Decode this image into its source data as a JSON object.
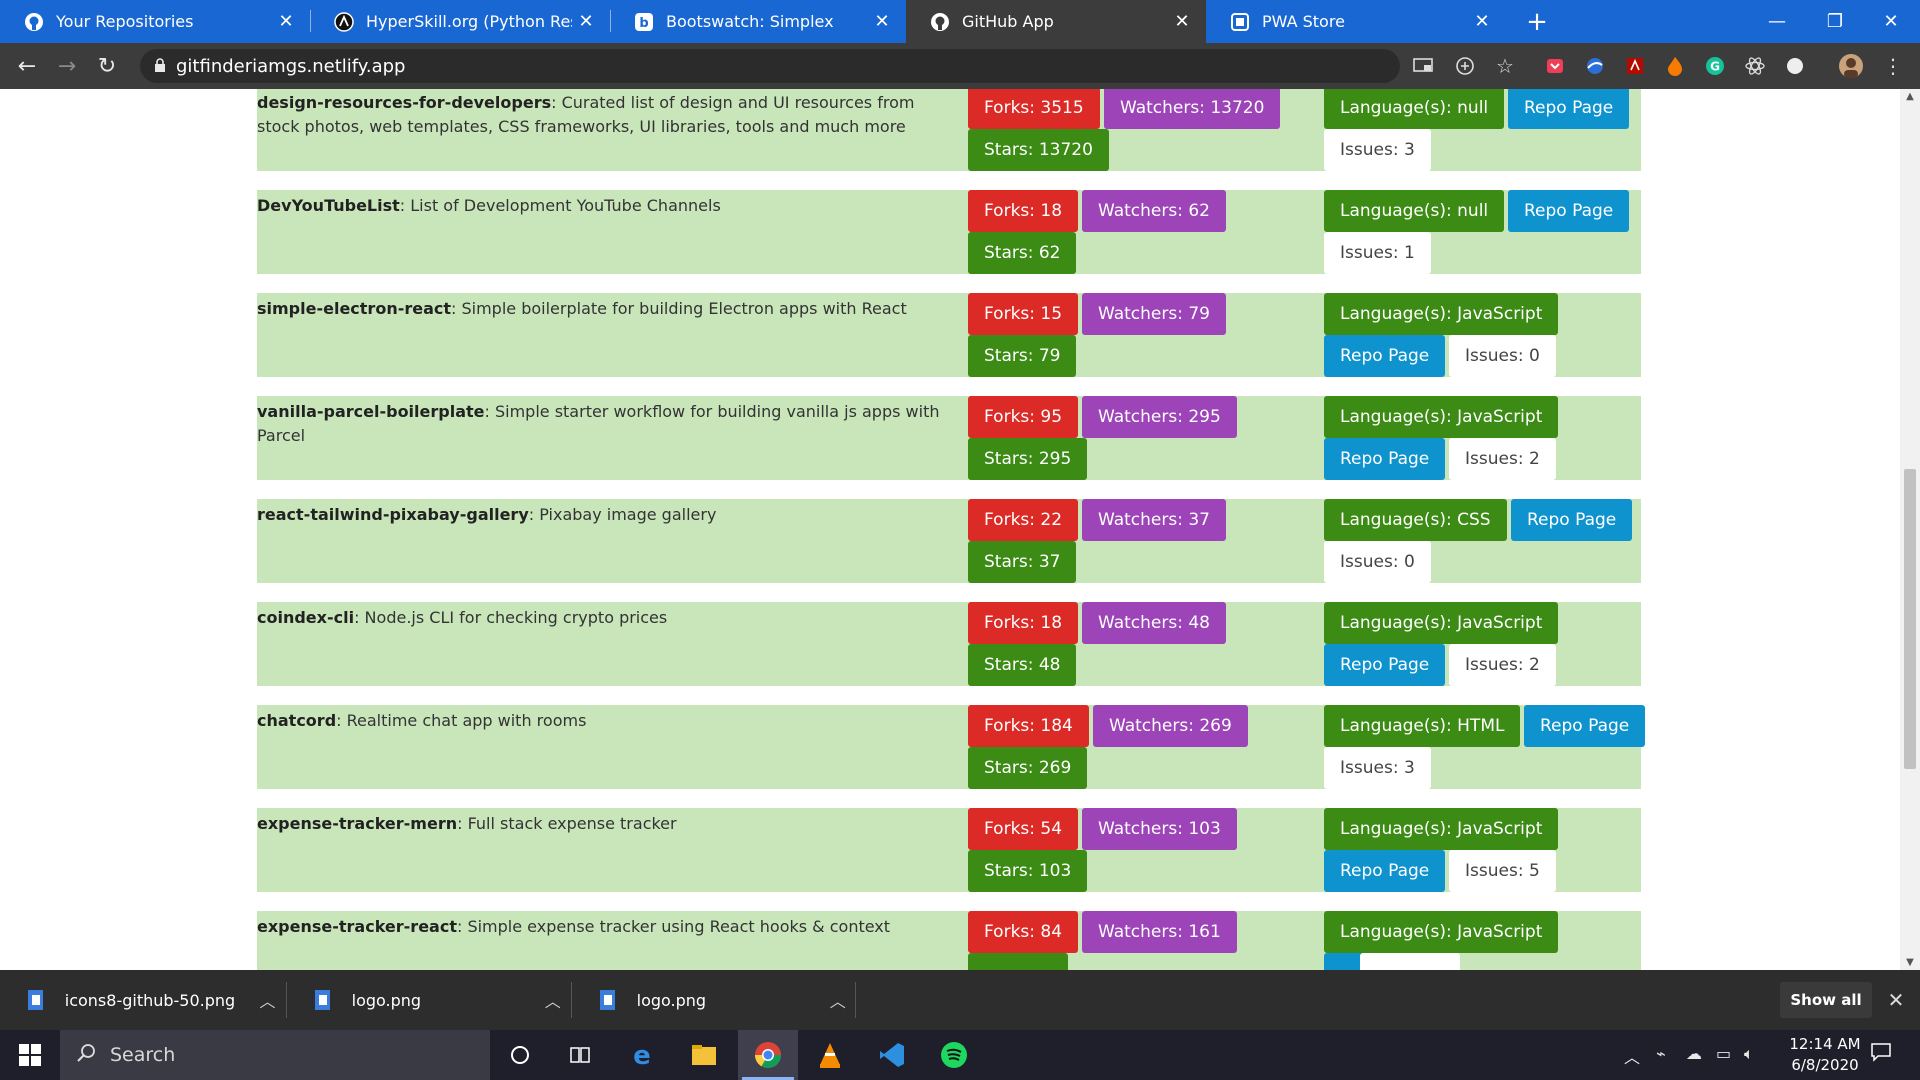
{
  "browser": {
    "tabs": [
      {
        "label": "Your Repositories",
        "icon": "github-icon",
        "active": false
      },
      {
        "label": "HyperSkill.org (Python Resource)",
        "icon": "hyperskill-icon",
        "active": false
      },
      {
        "label": "Bootswatch: Simplex",
        "icon": "bootstrap-icon",
        "active": false
      },
      {
        "label": "GitHub App",
        "icon": "github-icon",
        "active": true
      },
      {
        "label": "PWA Store",
        "icon": "pwa-icon",
        "active": false
      }
    ],
    "url": "gitfinderiamgs.netlify.app"
  },
  "repos": [
    {
      "name": "design-resources-for-developers",
      "description": ": Curated list of design and UI resources from stock photos, web templates, CSS frameworks, UI libraries, tools and much more",
      "forks": "Forks: 3515",
      "watchers": "Watchers: 13720",
      "stars": "Stars: 13720",
      "language": "Language(s): null",
      "repo_page": "Repo Page",
      "issues": "Issues: 3"
    },
    {
      "name": "DevYouTubeList",
      "description": ": List of Development YouTube Channels",
      "forks": "Forks: 18",
      "watchers": "Watchers: 62",
      "stars": "Stars: 62",
      "language": "Language(s): null",
      "repo_page": "Repo Page",
      "issues": "Issues: 1"
    },
    {
      "name": "simple-electron-react",
      "description": ": Simple boilerplate for building Electron apps with React",
      "forks": "Forks: 15",
      "watchers": "Watchers: 79",
      "stars": "Stars: 79",
      "language": "Language(s): JavaScript",
      "repo_page": "Repo Page",
      "issues": "Issues: 0"
    },
    {
      "name": "vanilla-parcel-boilerplate",
      "description": ": Simple starter workflow for building vanilla js apps with Parcel",
      "forks": "Forks: 95",
      "watchers": "Watchers: 295",
      "stars": "Stars: 295",
      "language": "Language(s): JavaScript",
      "repo_page": "Repo Page",
      "issues": "Issues: 2"
    },
    {
      "name": "react-tailwind-pixabay-gallery",
      "description": ": Pixabay image gallery",
      "forks": "Forks: 22",
      "watchers": "Watchers: 37",
      "stars": "Stars: 37",
      "language": "Language(s): CSS",
      "repo_page": "Repo Page",
      "issues": "Issues: 0"
    },
    {
      "name": "coindex-cli",
      "description": ": Node.js CLI for checking crypto prices",
      "forks": "Forks: 18",
      "watchers": "Watchers: 48",
      "stars": "Stars: 48",
      "language": "Language(s): JavaScript",
      "repo_page": "Repo Page",
      "issues": "Issues: 2"
    },
    {
      "name": "chatcord",
      "description": ": Realtime chat app with rooms",
      "forks": "Forks: 184",
      "watchers": "Watchers: 269",
      "stars": "Stars: 269",
      "language": "Language(s): HTML",
      "repo_page": "Repo Page",
      "issues": "Issues: 3"
    },
    {
      "name": "expense-tracker-mern",
      "description": ": Full stack expense tracker",
      "forks": "Forks: 54",
      "watchers": "Watchers: 103",
      "stars": "Stars: 103",
      "language": "Language(s): JavaScript",
      "repo_page": "Repo Page",
      "issues": "Issues: 5"
    },
    {
      "name": "expense-tracker-react",
      "description": ": Simple expense tracker using React hooks & context",
      "forks": "Forks: 84",
      "watchers": "Watchers: 161",
      "stars": "",
      "language": "Language(s): JavaScript",
      "repo_page": "",
      "issues": ""
    }
  ],
  "downloads": {
    "items": [
      {
        "name": "icons8-github-50.png"
      },
      {
        "name": "logo.png"
      },
      {
        "name": "logo.png"
      }
    ],
    "show_all": "Show all"
  },
  "taskbar": {
    "search_placeholder": "Search",
    "apps": [
      "task-view-icon",
      "edge-icon",
      "file-explorer-icon",
      "chrome-icon",
      "vlc-icon",
      "vscode-icon",
      "spotify-icon"
    ],
    "time": "12:14 AM",
    "date": "6/8/2020"
  },
  "colors": {
    "forks": "#dc2b27",
    "watchers": "#9c44b8",
    "stars": "#3c8b15",
    "repo_page": "#0f93cf",
    "row_bg": "#c9e6bb"
  }
}
